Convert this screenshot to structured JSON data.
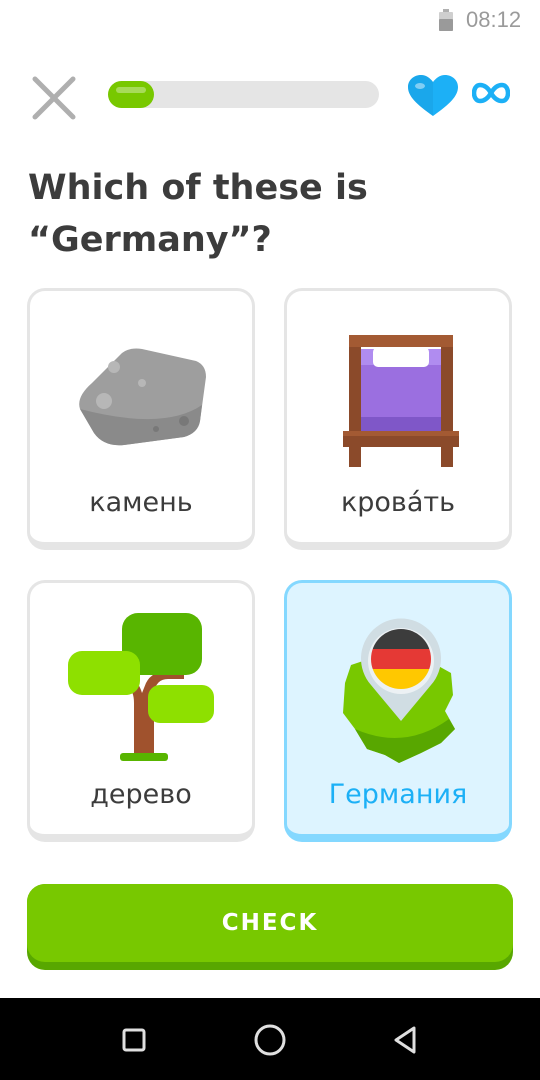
{
  "status_bar": {
    "time": "08:12",
    "battery_icon": "battery-icon"
  },
  "top_bar": {
    "close_icon": "close-icon",
    "progress": 0.17,
    "hearts_icon": "heart-icon",
    "hearts_value": "∞"
  },
  "question": {
    "text": "Which of these is “Germany”?"
  },
  "options": [
    {
      "label": "камень",
      "icon": "rock-icon",
      "selected": false
    },
    {
      "label": "кровáть",
      "icon": "bed-icon",
      "selected": false
    },
    {
      "label": "дерево",
      "icon": "tree-icon",
      "selected": false
    },
    {
      "label": "Германия",
      "icon": "germany-map-icon",
      "selected": true
    }
  ],
  "check_button": {
    "label": "CHECK"
  },
  "nav_bar": {
    "recents_icon": "square-icon",
    "home_icon": "circle-icon",
    "back_icon": "triangle-back-icon"
  },
  "colors": {
    "accent_green": "#78c800",
    "selected_blue": "#1cb0f6",
    "heart_blue": "#1cb0f6"
  }
}
